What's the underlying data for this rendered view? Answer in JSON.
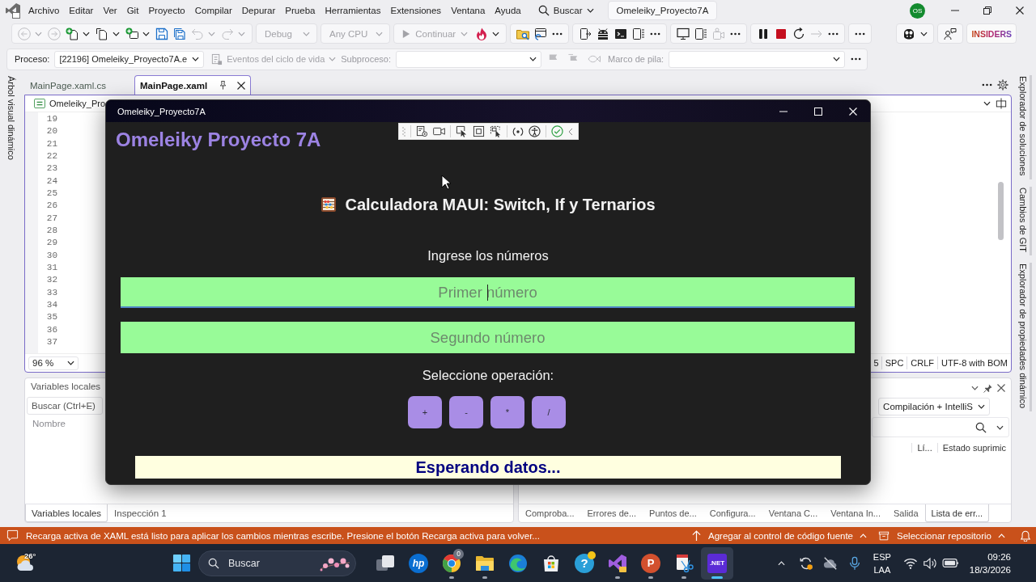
{
  "menu_bar": {
    "items": [
      "Archivo",
      "Editar",
      "Ver",
      "Git",
      "Proyecto",
      "Compilar",
      "Depurar",
      "Prueba",
      "Herramientas",
      "Extensiones",
      "Ventana",
      "Ayuda"
    ],
    "search": "Buscar",
    "solution": "Omeleiky_Proyecto7A",
    "account": "OS"
  },
  "toolbar": [
    [
      {
        "kind": "back",
        "disabled": true
      },
      {
        "kind": "forward",
        "disabled": true
      },
      {
        "kind": "new-project",
        "disabled": false
      },
      {
        "kind": "add-file",
        "disabled": false
      },
      {
        "kind": "add-item",
        "disabled": false
      },
      {
        "kind": "save",
        "disabled": false
      },
      {
        "kind": "save-all",
        "disabled": false
      },
      {
        "kind": "undo",
        "disabled": true
      },
      {
        "kind": "redo",
        "disabled": true
      }
    ],
    [
      {
        "kind": "dropdown",
        "label": "Debug",
        "disabled": true
      }
    ],
    [
      {
        "kind": "dropdown",
        "label": "Any CPU",
        "disabled": true
      }
    ],
    [
      {
        "kind": "run",
        "label": "Continuar",
        "disabled": true
      },
      {
        "kind": "hot-reload",
        "disabled": false
      }
    ],
    [
      {
        "kind": "folder-search",
        "disabled": false
      },
      {
        "kind": "browser",
        "disabled": false
      },
      {
        "kind": "more",
        "disabled": false
      }
    ],
    [
      {
        "kind": "device-run",
        "disabled": false
      },
      {
        "kind": "android",
        "disabled": false
      },
      {
        "kind": "terminal",
        "disabled": false
      },
      {
        "kind": "tablet",
        "disabled": false
      },
      {
        "kind": "more",
        "disabled": false
      }
    ],
    [
      {
        "kind": "monitor",
        "disabled": false
      },
      {
        "kind": "tablet",
        "disabled": false
      },
      {
        "kind": "camera",
        "disabled": true
      },
      {
        "kind": "more",
        "disabled": false
      }
    ],
    [
      {
        "kind": "pause",
        "disabled": false
      },
      {
        "kind": "stop",
        "disabled": false
      },
      {
        "kind": "restart",
        "disabled": false
      },
      {
        "kind": "step",
        "disabled": true
      },
      {
        "kind": "more",
        "disabled": false
      }
    ],
    [
      {
        "kind": "more",
        "disabled": false
      }
    ]
  ],
  "toolbar_badge": "INSIDERS",
  "debug_location": {
    "process_label": "Proceso:",
    "process": "[22196] Omeleiky_Proyecto7A.e",
    "lifecycle": {
      "label": "Eventos del ciclo de vida",
      "disabled": true
    },
    "thread_label": "Subproceso:",
    "flags": [
      {
        "kind": "flag",
        "disabled": true
      },
      {
        "kind": "flag-filter",
        "disabled": true
      },
      {
        "kind": "thread-marker",
        "disabled": true
      }
    ],
    "stack_label": "Marco de pila:"
  },
  "side_tabs": {
    "left": [
      "Árbol visual dinámico"
    ],
    "right": [
      "Explorador de soluciones",
      "Cambios de GIT",
      "Explorador de propiedades dinámico"
    ]
  },
  "editor": {
    "tabs": [
      {
        "label": "MainPage.xaml.cs",
        "selected": false
      },
      {
        "label": "MainPage.xaml",
        "selected": true
      }
    ],
    "scope": "Omeleiky_Pro",
    "line_numbers": [
      "19",
      "20",
      "21",
      "22",
      "23",
      "24",
      "25",
      "26",
      "27",
      "28",
      "29",
      "30",
      "31",
      "32",
      "33",
      "34",
      "35",
      "36",
      "37"
    ],
    "zoom": "96 %",
    "status": [
      "5",
      "SPC",
      "CRLF",
      "UTF-8 with BOM"
    ]
  },
  "locals_panel": {
    "title": "Variables locales",
    "search": {
      "placeholder": "Buscar (Ctrl+E)"
    },
    "columns": [
      "Nombre"
    ],
    "tabs": [
      {
        "label": "Variables locales",
        "selected": true
      },
      {
        "label": "Inspección 1",
        "selected": false
      }
    ]
  },
  "errors_panel": {
    "filter": "Compilación + IntelliS",
    "columns": [
      "Lí...",
      "Estado suprimic"
    ],
    "tabs": [
      {
        "label": "Comproba...",
        "selected": false
      },
      {
        "label": "Errores de...",
        "selected": false
      },
      {
        "label": "Puntos de...",
        "selected": false
      },
      {
        "label": "Configura...",
        "selected": false
      },
      {
        "label": "Ventana C...",
        "selected": false
      },
      {
        "label": "Ventana In...",
        "selected": false
      },
      {
        "label": "Salida",
        "selected": false
      },
      {
        "label": "Lista de err...",
        "selected": true
      }
    ]
  },
  "status_bar": {
    "message": "Recarga activa de XAML está listo para aplicar los cambios mientras escribe. Presione el botón Recarga activa para volver...",
    "actions": [
      {
        "kind": "source-control",
        "label": "Agregar al control de código fuente"
      },
      {
        "kind": "repository",
        "label": "Seleccionar repositorio"
      }
    ]
  },
  "taskbar": {
    "weather": "26°",
    "search": {
      "placeholder": "Buscar"
    },
    "apps": [
      {
        "kind": "task-view",
        "running": false,
        "selected": false
      },
      {
        "kind": "hp",
        "label": "hp",
        "running": false,
        "selected": false
      },
      {
        "kind": "chrome",
        "badge": "0",
        "running": true,
        "selected": false
      },
      {
        "kind": "explorer",
        "running": true,
        "selected": false
      },
      {
        "kind": "edge",
        "running": false,
        "selected": false
      },
      {
        "kind": "store",
        "running": false,
        "selected": false
      },
      {
        "kind": "help",
        "label": "?",
        "running": false,
        "selected": false
      },
      {
        "kind": "visual-studio",
        "running": true,
        "selected": false
      },
      {
        "kind": "powerpoint",
        "label": "P",
        "running": true,
        "selected": false
      },
      {
        "kind": "snipping",
        "running": true,
        "selected": false
      },
      {
        "kind": "dotnet",
        "label": ".NET",
        "running": true,
        "selected": true
      }
    ],
    "tray": {
      "language": [
        "ESP",
        "LAA"
      ],
      "time": "09:26",
      "date": "18/3/2026"
    }
  },
  "app_window": {
    "title": "Omeleiky_Proyecto7A",
    "header": "Omeleiky Proyecto 7A",
    "heading": "Calculadora MAUI: Switch, If y Ternarios",
    "prompt": "Ingrese los números",
    "entries": [
      {
        "placeholder": "Primer número",
        "focused": true
      },
      {
        "placeholder": "Segundo número",
        "focused": false
      }
    ],
    "operation_label": "Seleccione operación:",
    "operations": [
      "+",
      "-",
      "*",
      "/"
    ],
    "result": "Esperando datos..."
  }
}
